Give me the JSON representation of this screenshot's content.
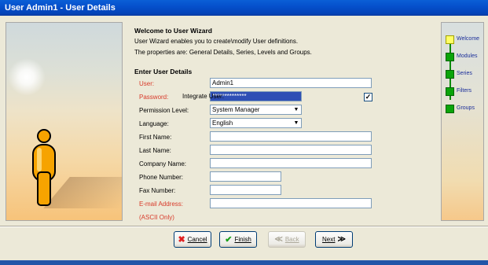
{
  "window": {
    "title": "User Admin1 - User Details"
  },
  "intro": {
    "title": "Welcome to User Wizard",
    "line1": "User Wizard enables you to create\\modify User definitions.",
    "line2": "The properties are: General Details, Series, Levels and Groups."
  },
  "section_title": "Enter User Details",
  "form": {
    "user_label": "User:",
    "user_value": "Admin1",
    "password_label": "Password:",
    "password_value": "**************",
    "integrate_label": "Integrate User:",
    "integrate_checked": "✓",
    "permission_label": "Permission Level:",
    "permission_value": "System Manager",
    "language_label": "Language:",
    "language_value": "English",
    "first_name_label": "First Name:",
    "first_name_value": "",
    "last_name_label": "Last Name:",
    "last_name_value": "",
    "company_label": "Company Name:",
    "company_value": "",
    "phone_label": "Phone Number:",
    "phone_value": "",
    "fax_label": "Fax Number:",
    "fax_value": "",
    "email_label": "E-mail Address:",
    "email_value": "",
    "ascii_note": "(ASCII Only)"
  },
  "steps": [
    {
      "label": "Welcome",
      "state": "current"
    },
    {
      "label": "Modules",
      "state": "pending"
    },
    {
      "label": "Series",
      "state": "pending"
    },
    {
      "label": "Filters",
      "state": "pending"
    },
    {
      "label": "Groups",
      "state": "pending"
    }
  ],
  "buttons": {
    "cancel": "Cancel",
    "finish": "Finish",
    "back": "Back",
    "next": "Next"
  },
  "icons": {
    "cancel": "red-x-icon",
    "finish": "green-check-icon",
    "back": "double-left-arrow-icon",
    "next": "double-right-arrow-icon"
  },
  "colors": {
    "required_label": "#d83a2a",
    "step_done": "#0aa40a",
    "step_current": "#ffff66",
    "title_bar": "#0550cc"
  }
}
